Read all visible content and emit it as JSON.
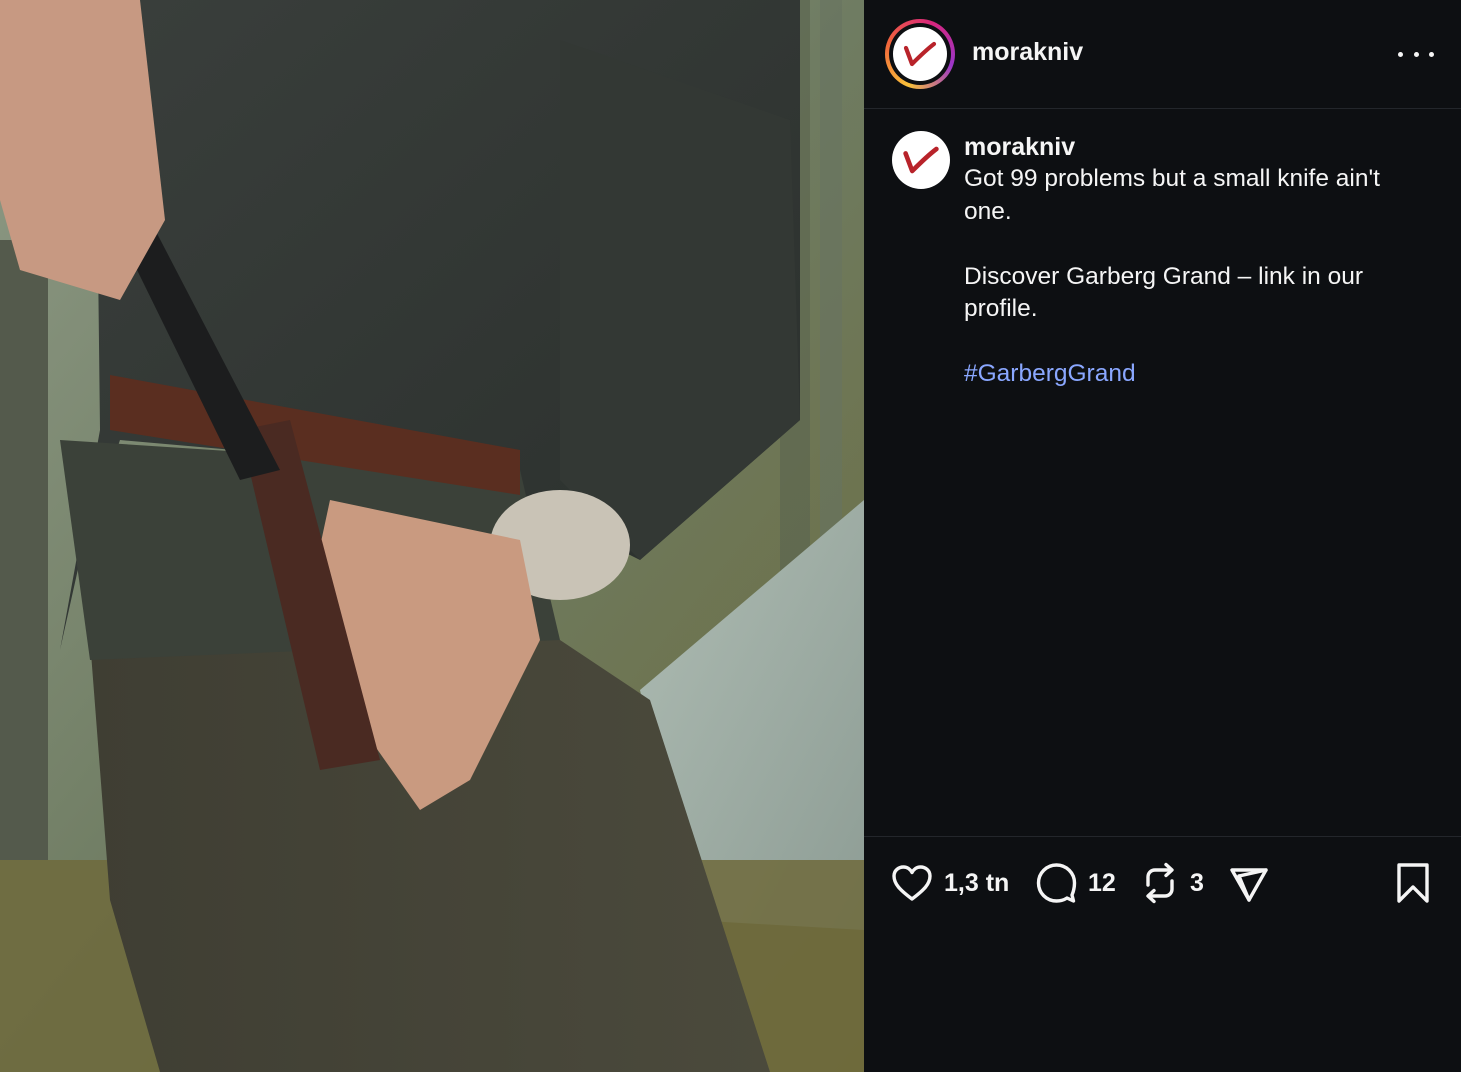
{
  "post": {
    "username": "morakniv",
    "more_options_icon": "more-horizontal-icon",
    "caption": {
      "username": "morakniv",
      "line1": "Got 99 problems but a small knife ain't one.",
      "line2": "Discover Garberg Grand – link in our profile.",
      "hashtag": "#GarbergGrand"
    },
    "actions": {
      "like_count": "1,3 tn",
      "comment_count": "12",
      "repost_count": "3",
      "icons": [
        "heart-icon",
        "comment-icon",
        "repost-icon",
        "share-icon",
        "bookmark-icon"
      ]
    },
    "colors": {
      "background": "#0d0f12",
      "text": "#f5f5f5",
      "hashtag": "#8aa7ff",
      "logo_red": "#b8232a"
    }
  }
}
